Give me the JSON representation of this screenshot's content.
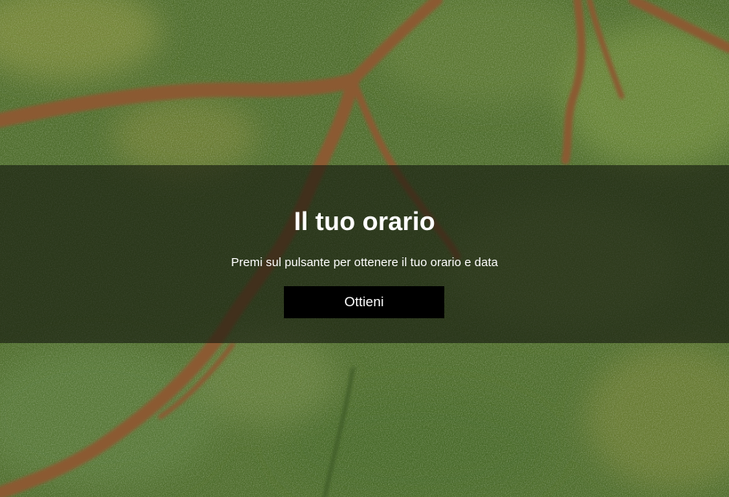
{
  "hero": {
    "title": "Il tuo orario",
    "subtitle": "Premi sul pulsante per ottenere il tuo orario e data",
    "button_label": "Ottieni"
  },
  "colors": {
    "overlay": "#14160e",
    "button_bg": "#000000",
    "text": "#ffffff",
    "grass": "#4e6b2c",
    "path": "#8a5a30"
  }
}
